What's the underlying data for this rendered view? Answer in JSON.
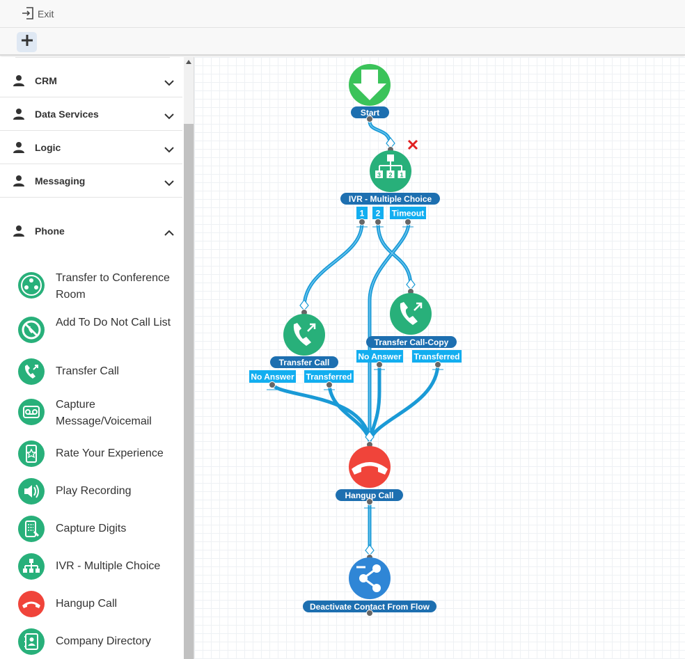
{
  "topbar": {
    "exit_label": "Exit"
  },
  "sidebar": {
    "sections": [
      {
        "label": "CRM",
        "expanded": false
      },
      {
        "label": "Data Services",
        "expanded": false
      },
      {
        "label": "Logic",
        "expanded": false
      },
      {
        "label": "Messaging",
        "expanded": false
      },
      {
        "label": "Phone",
        "expanded": true
      }
    ],
    "tools": [
      {
        "label": "Transfer to Conference Room",
        "icon": "conference-room-icon"
      },
      {
        "label": "Add To Do Not Call List",
        "icon": "do-not-call-icon"
      },
      {
        "label": "Transfer Call",
        "icon": "transfer-call-icon"
      },
      {
        "label": "Capture Message/Voicemail",
        "icon": "voicemail-icon"
      },
      {
        "label": "Rate Your Experience",
        "icon": "rate-experience-icon"
      },
      {
        "label": "Play Recording",
        "icon": "play-recording-icon"
      },
      {
        "label": "Capture Digits",
        "icon": "capture-digits-icon"
      },
      {
        "label": "IVR - Multiple Choice",
        "icon": "ivr-icon"
      },
      {
        "label": "Hangup Call",
        "icon": "hangup-icon"
      },
      {
        "label": "Company Directory",
        "icon": "directory-icon"
      }
    ]
  },
  "flow": {
    "nodes": {
      "start": {
        "label": "Start",
        "color": "#3bc35a"
      },
      "ivr": {
        "label": "IVR - Multiple Choice",
        "color": "#28b07a",
        "ports": [
          "1",
          "2",
          "Timeout"
        ],
        "icon_digits": [
          "3",
          "2",
          "1"
        ]
      },
      "transfer_call": {
        "label": "Transfer Call",
        "color": "#28b07a",
        "ports": [
          "No Answer",
          "Transferred"
        ]
      },
      "transfer_call_copy": {
        "label": "Transfer Call-Copy",
        "color": "#28b07a",
        "ports": [
          "No Answer",
          "Transferred"
        ]
      },
      "hangup": {
        "label": "Hangup Call",
        "color": "#f0443a"
      },
      "deactivate": {
        "label": "Deactivate Contact From Flow",
        "color": "#2f86d6"
      }
    },
    "colors": {
      "link": "#1a9ad6",
      "label_bg": "#1d6fb0",
      "port_bg": "#12aef0",
      "delete": "#e02020"
    }
  }
}
